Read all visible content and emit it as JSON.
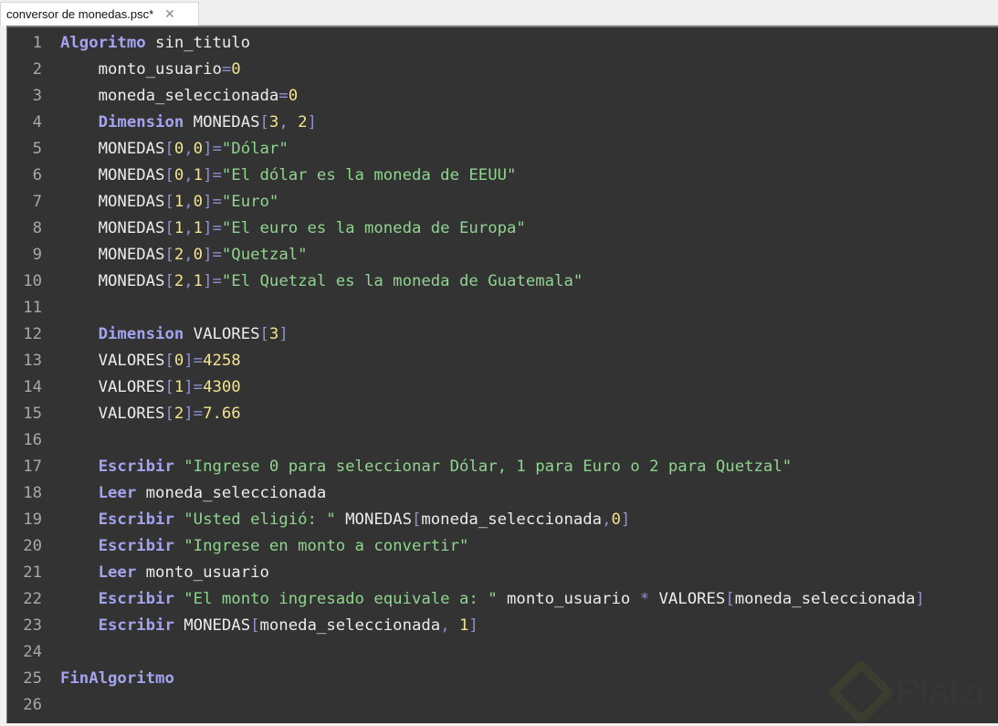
{
  "tab": {
    "title": "conversor de monedas.psc*",
    "close_glyph": "✕"
  },
  "watermark": "Platzi",
  "colors": {
    "background": "#333333",
    "keyword": "#a3a3f0",
    "string": "#8fd48f",
    "number": "#f2e38c",
    "operator": "#8e8ed2",
    "identifier": "#ececec"
  },
  "lines": [
    [
      [
        "k",
        "Algoritmo"
      ],
      [
        "i",
        " sin_titulo"
      ]
    ],
    [
      [
        "i",
        "    monto_usuario"
      ],
      [
        "o",
        "="
      ],
      [
        "n",
        "0"
      ]
    ],
    [
      [
        "i",
        "    moneda_seleccionada"
      ],
      [
        "o",
        "="
      ],
      [
        "n",
        "0"
      ]
    ],
    [
      [
        "i",
        "    "
      ],
      [
        "k",
        "Dimension"
      ],
      [
        "i",
        " MONEDAS"
      ],
      [
        "o",
        "["
      ],
      [
        "n",
        "3"
      ],
      [
        "o",
        ", "
      ],
      [
        "n",
        "2"
      ],
      [
        "o",
        "]"
      ]
    ],
    [
      [
        "i",
        "    MONEDAS"
      ],
      [
        "o",
        "["
      ],
      [
        "n",
        "0"
      ],
      [
        "o",
        ","
      ],
      [
        "n",
        "0"
      ],
      [
        "o",
        "]="
      ],
      [
        "s",
        "\"Dólar\""
      ]
    ],
    [
      [
        "i",
        "    MONEDAS"
      ],
      [
        "o",
        "["
      ],
      [
        "n",
        "0"
      ],
      [
        "o",
        ","
      ],
      [
        "n",
        "1"
      ],
      [
        "o",
        "]="
      ],
      [
        "s",
        "\"El dólar es la moneda de EEUU\""
      ]
    ],
    [
      [
        "i",
        "    MONEDAS"
      ],
      [
        "o",
        "["
      ],
      [
        "n",
        "1"
      ],
      [
        "o",
        ","
      ],
      [
        "n",
        "0"
      ],
      [
        "o",
        "]="
      ],
      [
        "s",
        "\"Euro\""
      ]
    ],
    [
      [
        "i",
        "    MONEDAS"
      ],
      [
        "o",
        "["
      ],
      [
        "n",
        "1"
      ],
      [
        "o",
        ","
      ],
      [
        "n",
        "1"
      ],
      [
        "o",
        "]="
      ],
      [
        "s",
        "\"El euro es la moneda de Europa\""
      ]
    ],
    [
      [
        "i",
        "    MONEDAS"
      ],
      [
        "o",
        "["
      ],
      [
        "n",
        "2"
      ],
      [
        "o",
        ","
      ],
      [
        "n",
        "0"
      ],
      [
        "o",
        "]="
      ],
      [
        "s",
        "\"Quetzal\""
      ]
    ],
    [
      [
        "i",
        "    MONEDAS"
      ],
      [
        "o",
        "["
      ],
      [
        "n",
        "2"
      ],
      [
        "o",
        ","
      ],
      [
        "n",
        "1"
      ],
      [
        "o",
        "]="
      ],
      [
        "s",
        "\"El Quetzal es la moneda de Guatemala\""
      ]
    ],
    [],
    [
      [
        "i",
        "    "
      ],
      [
        "k",
        "Dimension"
      ],
      [
        "i",
        " VALORES"
      ],
      [
        "o",
        "["
      ],
      [
        "n",
        "3"
      ],
      [
        "o",
        "]"
      ]
    ],
    [
      [
        "i",
        "    VALORES"
      ],
      [
        "o",
        "["
      ],
      [
        "n",
        "0"
      ],
      [
        "o",
        "]="
      ],
      [
        "n",
        "4258"
      ]
    ],
    [
      [
        "i",
        "    VALORES"
      ],
      [
        "o",
        "["
      ],
      [
        "n",
        "1"
      ],
      [
        "o",
        "]="
      ],
      [
        "n",
        "4300"
      ]
    ],
    [
      [
        "i",
        "    VALORES"
      ],
      [
        "o",
        "["
      ],
      [
        "n",
        "2"
      ],
      [
        "o",
        "]="
      ],
      [
        "n",
        "7.66"
      ]
    ],
    [],
    [
      [
        "i",
        "    "
      ],
      [
        "k",
        "Escribir"
      ],
      [
        "i",
        " "
      ],
      [
        "s",
        "\"Ingrese 0 para seleccionar Dólar, 1 para Euro o 2 para Quetzal\""
      ]
    ],
    [
      [
        "i",
        "    "
      ],
      [
        "k",
        "Leer"
      ],
      [
        "i",
        " moneda_seleccionada"
      ]
    ],
    [
      [
        "i",
        "    "
      ],
      [
        "k",
        "Escribir"
      ],
      [
        "i",
        " "
      ],
      [
        "s",
        "\"Usted eligió: \""
      ],
      [
        "i",
        " MONEDAS"
      ],
      [
        "o",
        "["
      ],
      [
        "i",
        "moneda_seleccionada"
      ],
      [
        "o",
        ","
      ],
      [
        "n",
        "0"
      ],
      [
        "o",
        "]"
      ]
    ],
    [
      [
        "i",
        "    "
      ],
      [
        "k",
        "Escribir"
      ],
      [
        "i",
        " "
      ],
      [
        "s",
        "\"Ingrese en monto a convertir\""
      ]
    ],
    [
      [
        "i",
        "    "
      ],
      [
        "k",
        "Leer"
      ],
      [
        "i",
        " monto_usuario"
      ]
    ],
    [
      [
        "i",
        "    "
      ],
      [
        "k",
        "Escribir"
      ],
      [
        "i",
        " "
      ],
      [
        "s",
        "\"El monto ingresado equivale a: \""
      ],
      [
        "i",
        " monto_usuario "
      ],
      [
        "o",
        "*"
      ],
      [
        "i",
        " VALORES"
      ],
      [
        "o",
        "["
      ],
      [
        "i",
        "moneda_seleccionada"
      ],
      [
        "o",
        "]"
      ]
    ],
    [
      [
        "i",
        "    "
      ],
      [
        "k",
        "Escribir"
      ],
      [
        "i",
        " MONEDAS"
      ],
      [
        "o",
        "["
      ],
      [
        "i",
        "moneda_seleccionada"
      ],
      [
        "o",
        ", "
      ],
      [
        "n",
        "1"
      ],
      [
        "o",
        "]"
      ]
    ],
    [],
    [
      [
        "k",
        "FinAlgoritmo"
      ]
    ],
    []
  ]
}
